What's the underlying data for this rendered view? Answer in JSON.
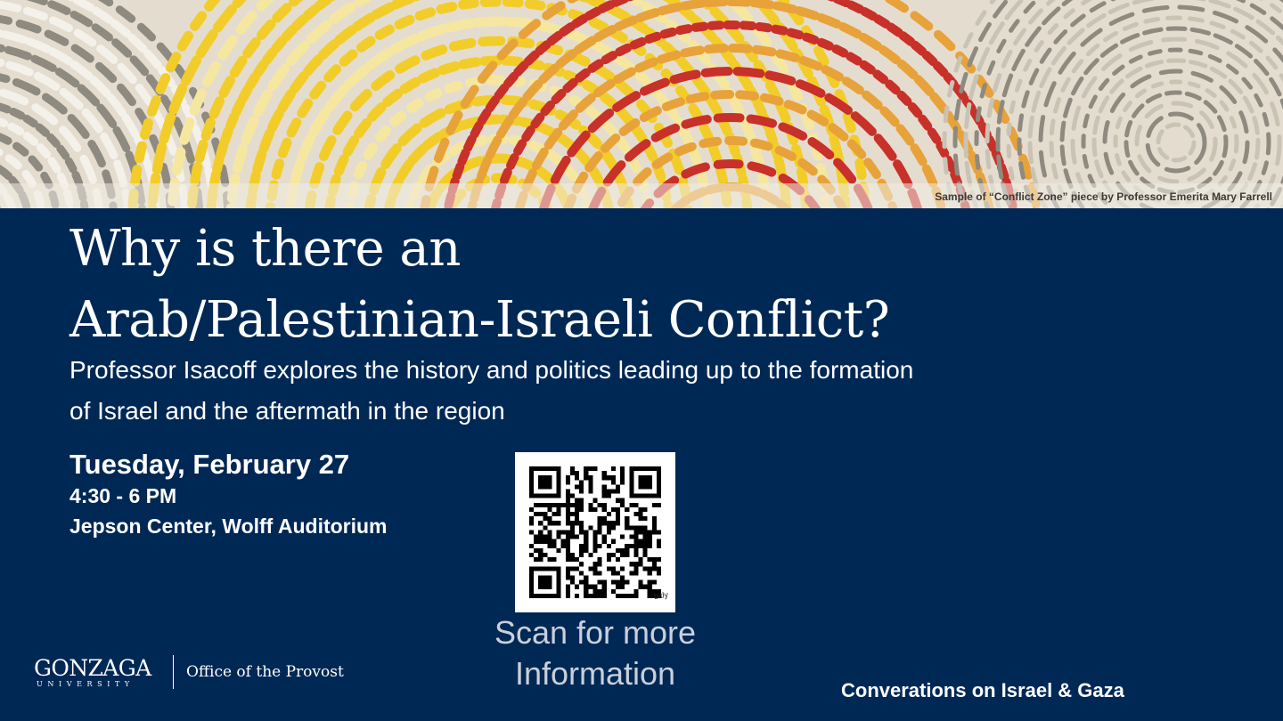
{
  "banner": {
    "artwork_credit": "Sample of “Conflict Zone” piece by Professor Emerita Mary Farrell",
    "palette": {
      "background": "#e4ddcf",
      "yellow": "#f2cd2a",
      "orange": "#e8a23a",
      "red": "#c8302a",
      "grey": "#8f8a80"
    }
  },
  "headline": {
    "line1": "Why is there an",
    "line2": "Arab/Palestinian-Israeli Conflict?"
  },
  "description": {
    "line1": "Professor Isacoff explores the history and politics leading up to the formation",
    "line2": "of Israel and the aftermath in the region"
  },
  "event": {
    "date": "Tuesday, February 27",
    "time": "4:30 - 6 PM",
    "location": "Jepson Center, Wolff Auditorium"
  },
  "qr": {
    "brand": "bitly",
    "caption_line1": "Scan for more",
    "caption_line2": "Information",
    "icon": "qr-code-icon"
  },
  "footer": {
    "logo_word": "GONZAGA",
    "logo_subword": "UNIVERSITY",
    "office": "Office of the Provost",
    "series": "Converations on Israel & Gaza"
  },
  "colors": {
    "navy_background": "#002855",
    "text": "#ffffff",
    "caption_grey": "#c9d0da"
  }
}
